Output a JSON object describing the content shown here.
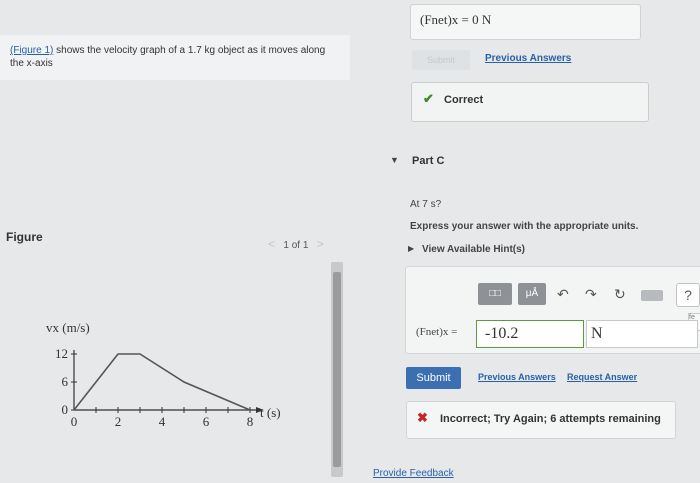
{
  "problem": {
    "link": "(Figure 1)",
    "text": " shows the velocity graph of a 1.7 kg object as it moves along the x-axis"
  },
  "figure": {
    "title": "Figure",
    "pager": "1 of 1",
    "prev_arrow": "<",
    "next_arrow": ">"
  },
  "chart_data": {
    "type": "line",
    "ylabel": "vx (m/s)",
    "xlabel": "t (s)",
    "x": [
      0,
      2,
      3,
      5,
      8
    ],
    "y": [
      0,
      12,
      12,
      6,
      0
    ],
    "x_ticks": [
      "0",
      "2",
      "4",
      "6",
      "8"
    ],
    "y_ticks": [
      "0",
      "6",
      "12"
    ],
    "xlim": [
      0,
      8
    ],
    "ylim": [
      0,
      12
    ]
  },
  "previous_part": {
    "answer_label": "(Fnet)x = 0 N",
    "submit_label": "Submit",
    "previous_answers": "Previous Answers",
    "result": "Correct"
  },
  "part_c": {
    "title": "Part C",
    "question": "At 7 s?",
    "instructions": "Express your answer with the appropriate units.",
    "hints": "View Available Hint(s)",
    "toolbar": {
      "templates_label": "□□",
      "units_label": "μÅ"
    },
    "equation_label": "(Fnet)x =",
    "value": "-10.2",
    "unit": "N",
    "side_tab": "fe",
    "submit_label": "Submit",
    "previous_answers": "Previous Answers",
    "request_answer": "Request Answer",
    "result": "Incorrect; Try Again; 6 attempts remaining"
  },
  "footer": {
    "feedback": "Provide Feedback"
  }
}
